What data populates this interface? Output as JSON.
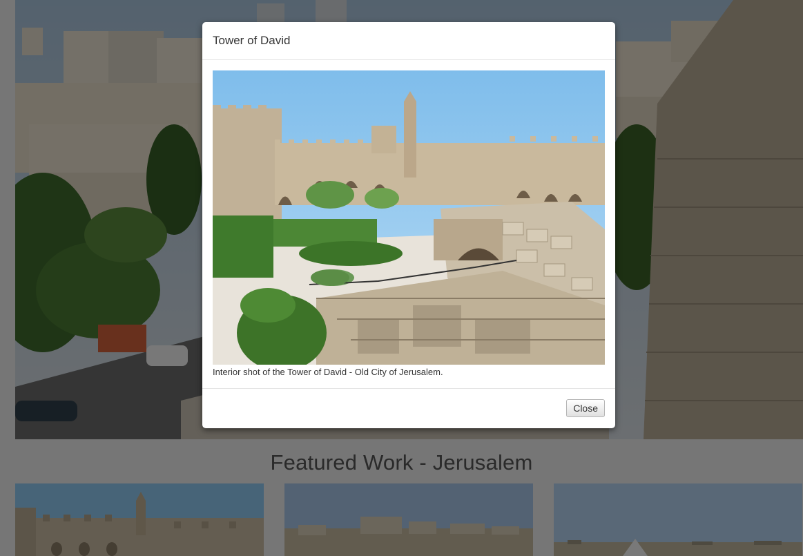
{
  "page": {
    "featured_title": "Featured Work - Jerusalem",
    "thumbnails": [
      {
        "subject": "citadel walls"
      },
      {
        "subject": "city skyline"
      },
      {
        "subject": "hilltop view"
      }
    ]
  },
  "modal": {
    "title": "Tower of David",
    "caption": "Interior shot of the Tower of David - Old City of Jerusalem.",
    "close_label": "Close"
  },
  "colors": {
    "backdrop": "rgba(0,0,0,0.5)",
    "sky": "#8ec9f0",
    "stone": "#c8bba3",
    "foliage": "#3f7a2c"
  }
}
